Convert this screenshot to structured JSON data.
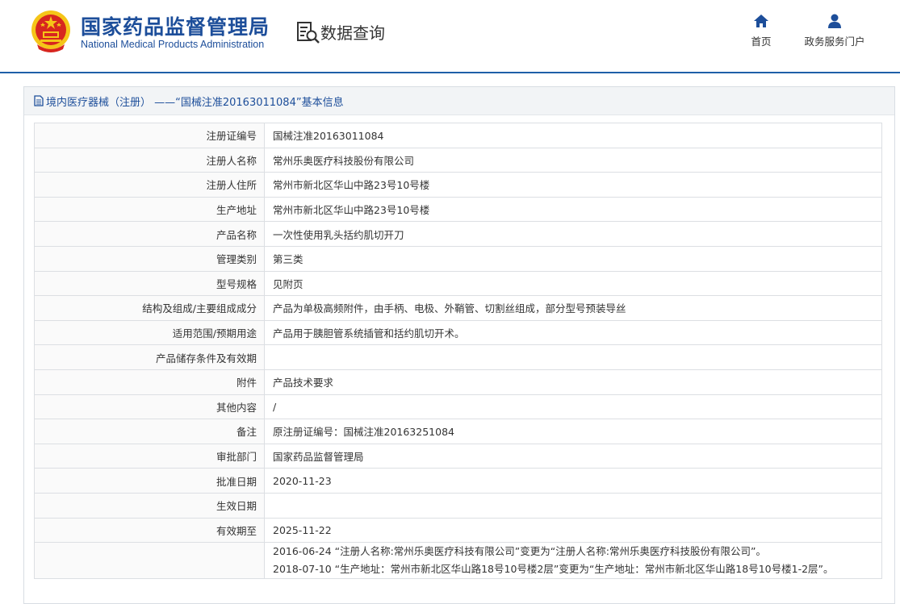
{
  "header": {
    "org_name_cn": "国家药品监督管理局",
    "org_name_en": "National Medical Products Administration",
    "section_title": "数据查询",
    "nav": [
      {
        "label": "首页",
        "icon": "home-icon"
      },
      {
        "label": "政务服务门户",
        "icon": "user-icon"
      }
    ]
  },
  "panel": {
    "title": "境内医疗器械（注册） ——“国械注准20163011084”基本信息"
  },
  "rows": [
    {
      "label": "注册证编号",
      "value": "国械注准20163011084"
    },
    {
      "label": "注册人名称",
      "value": "常州乐奥医疗科技股份有限公司"
    },
    {
      "label": "注册人住所",
      "value": "常州市新北区华山中路23号10号楼"
    },
    {
      "label": "生产地址",
      "value": "常州市新北区华山中路23号10号楼"
    },
    {
      "label": "产品名称",
      "value": "一次性使用乳头括约肌切开刀"
    },
    {
      "label": "管理类别",
      "value": "第三类"
    },
    {
      "label": "型号规格",
      "value": "见附页"
    },
    {
      "label": "结构及组成/主要组成成分",
      "value": "产品为单极高频附件，由手柄、电极、外鞘管、切割丝组成，部分型号预装导丝"
    },
    {
      "label": "适用范围/预期用途",
      "value": "产品用于胰胆管系统插管和括约肌切开术。"
    },
    {
      "label": "产品储存条件及有效期",
      "value": ""
    },
    {
      "label": "附件",
      "value": "产品技术要求"
    },
    {
      "label": "其他内容",
      "value": "/"
    },
    {
      "label": "备注",
      "value": "原注册证编号：国械注准20163251084"
    },
    {
      "label": "审批部门",
      "value": "国家药品监督管理局"
    },
    {
      "label": "批准日期",
      "value": "2020-11-23"
    },
    {
      "label": "生效日期",
      "value": ""
    },
    {
      "label": "有效期至",
      "value": "2025-11-22"
    }
  ],
  "changes": [
    "2016-06-24 “注册人名称:常州乐奥医疗科技有限公司”变更为“注册人名称:常州乐奥医疗科技股份有限公司”。",
    "2018-07-10 “生产地址：常州市新北区华山路18号10号楼2层”变更为“生产地址：常州市新北区华山路18号10号楼1-2层”。"
  ],
  "colors": {
    "brand_blue": "#1d4e9a",
    "emblem_red": "#d7261f",
    "emblem_gold": "#f5c518"
  }
}
